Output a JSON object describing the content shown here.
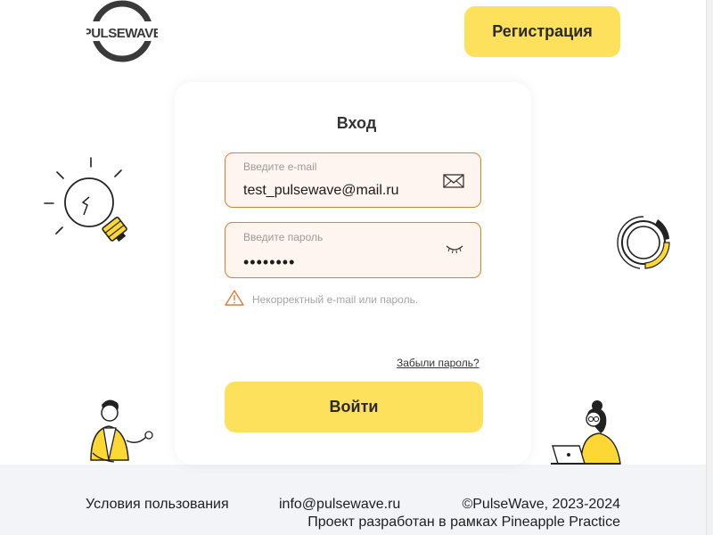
{
  "header": {
    "brand_name": "PULSEWAVE",
    "register_label": "Регистрация"
  },
  "login": {
    "title": "Вход",
    "email": {
      "label": "Введите e-mail",
      "value": "test_pulsewave@mail.ru",
      "icon": "envelope-icon"
    },
    "password": {
      "label": "Введите пароль",
      "value": "••••••••",
      "icon": "eye-closed-icon"
    },
    "error": {
      "icon": "warning-icon",
      "text": "Некорректный e-mail или пароль."
    },
    "forgot_label": "Забыли пароль?",
    "submit_label": "Войти"
  },
  "footer": {
    "terms": "Условия пользования",
    "email": "info@pulsewave.ru",
    "copyright": "©PulseWave, 2023-2024",
    "project": "Проект разработан в рамках Pineapple Practice"
  },
  "colors": {
    "accent": "#fde15c",
    "field_border": "#d9822b",
    "field_bg": "#fff5f0",
    "footer_bg": "#f3f4f8"
  }
}
